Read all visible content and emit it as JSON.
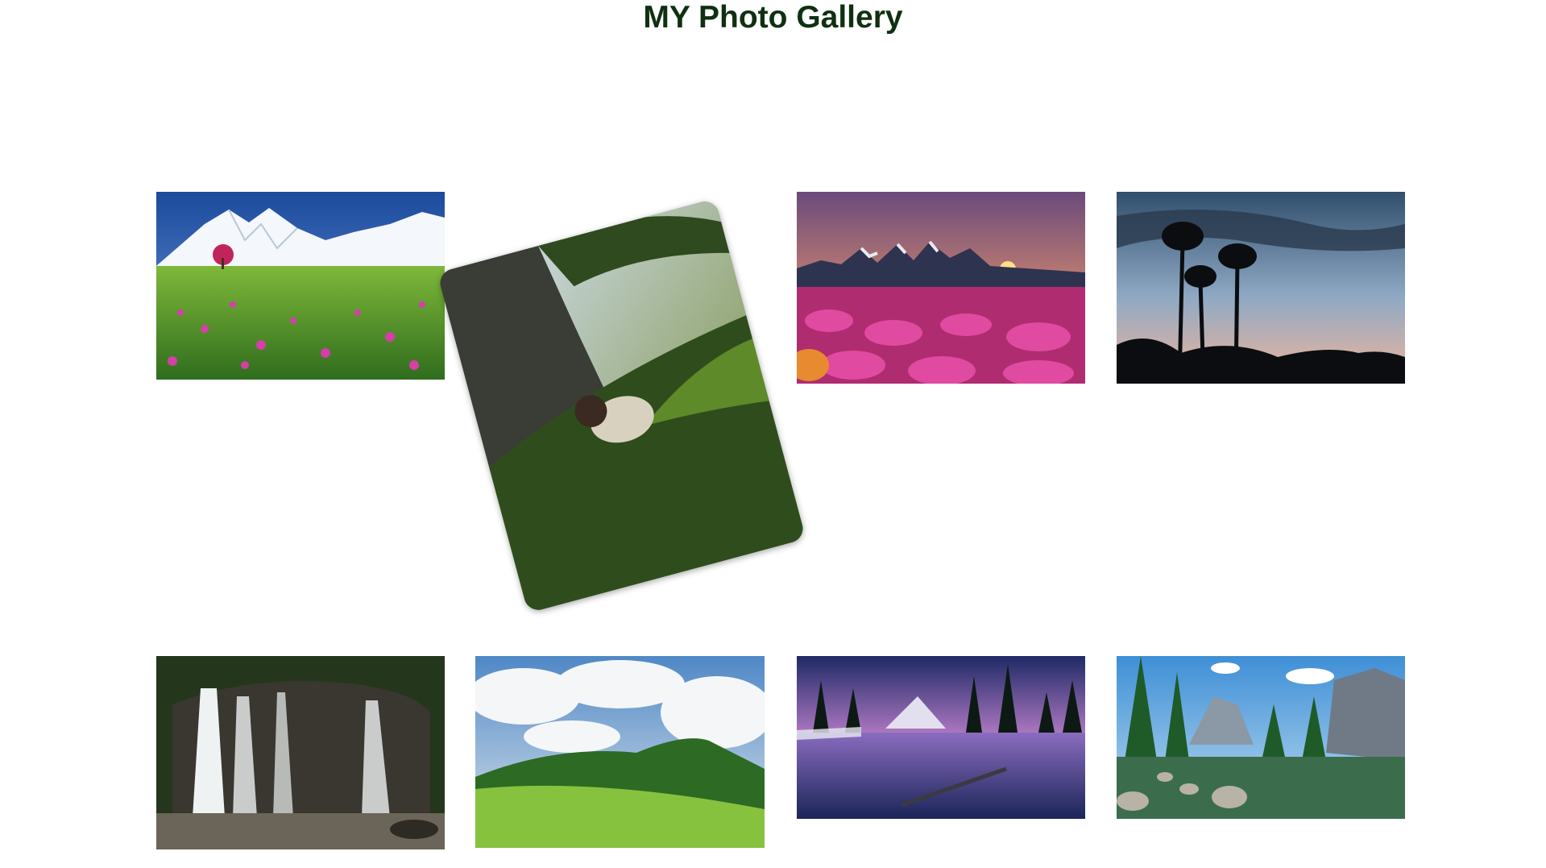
{
  "page": {
    "title": "MY Photo Gallery"
  },
  "colors": {
    "title": "#0f3012",
    "background": "#ffffff"
  },
  "gallery": {
    "photos": [
      {
        "subject": "snowy-mountain-flower-meadow"
      },
      {
        "subject": "child-under-tree-in-grass",
        "state": "tilted"
      },
      {
        "subject": "sunset-over-mountains-pink-flowers"
      },
      {
        "subject": "palm-silhouettes-at-dusk"
      },
      {
        "subject": "waterfall-in-forest"
      },
      {
        "subject": "green-hill-with-clouds"
      },
      {
        "subject": "night-lake-reflection"
      },
      {
        "subject": "valley-river-with-cliffs"
      }
    ]
  }
}
